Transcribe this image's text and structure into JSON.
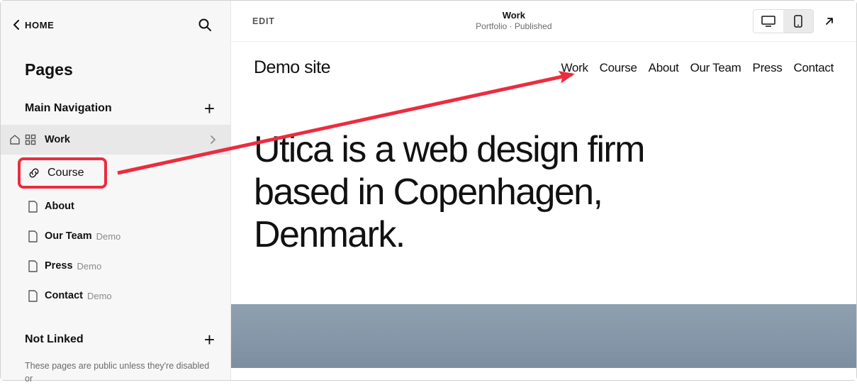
{
  "sidebar": {
    "home_label": "HOME",
    "title": "Pages",
    "main_nav_label": "Main Navigation",
    "not_linked_label": "Not Linked",
    "not_linked_desc": "These pages are public unless they're disabled or",
    "items": [
      {
        "label": "Work",
        "demo": ""
      },
      {
        "label": "Course",
        "demo": ""
      },
      {
        "label": "About",
        "demo": ""
      },
      {
        "label": "Our Team",
        "demo": "Demo"
      },
      {
        "label": "Press",
        "demo": "Demo"
      },
      {
        "label": "Contact",
        "demo": "Demo"
      }
    ]
  },
  "topbar": {
    "edit_label": "EDIT",
    "title": "Work",
    "subtitle": "Portfolio · Published"
  },
  "site": {
    "title": "Demo site",
    "nav": [
      "Work",
      "Course",
      "About",
      "Our Team",
      "Press",
      "Contact"
    ],
    "hero": "Utica is a web design firm based in Copenhagen, Denmark."
  }
}
